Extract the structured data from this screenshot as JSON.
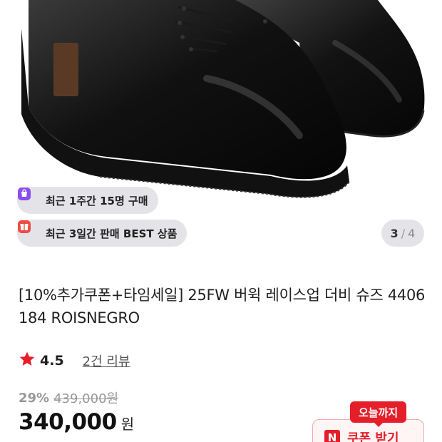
{
  "gallery": {
    "image_alt": "shoe-photo",
    "badges": [
      {
        "text": "최근 1주간 15명 구매",
        "icon": "shopping-bag-icon"
      },
      {
        "text": "최근 3일간 판매 BEST 상품",
        "icon": "gift-icon"
      }
    ],
    "counter": {
      "current": "3",
      "separator": "/",
      "total": "4"
    }
  },
  "product": {
    "title": "[10%추가쿠폰+타임세일] 25FW 버윅 레이스업 더비 슈즈 4406 184 ROISNEGRO",
    "rating": {
      "score": "4.5",
      "reviews": "2건 리뷰"
    },
    "discount_rate": "29%",
    "original_price": "439,000원",
    "price": "340,000",
    "currency": "원"
  },
  "coupon": {
    "tag": "오늘까지",
    "icon_letter": "N",
    "label": "쿠폰 받기"
  },
  "colors": {
    "accent_red": "#e41f2a",
    "badge_bg": "#e2e2e6",
    "shoe": "#0c0c0c"
  }
}
